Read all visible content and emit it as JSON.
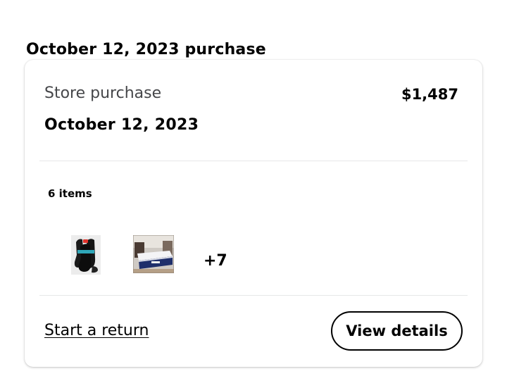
{
  "page": {
    "heading": "October 12, 2023 purchase"
  },
  "order": {
    "store_label": "Store purchase",
    "amount": "$1,487",
    "date": "October 12, 2023",
    "items_count": "6 items",
    "thumbnails": [
      {
        "name": "black socks pack"
      },
      {
        "name": "mattress"
      }
    ],
    "more_count": "+7"
  },
  "actions": {
    "start_return": "Start a return",
    "view_details": "View details"
  }
}
